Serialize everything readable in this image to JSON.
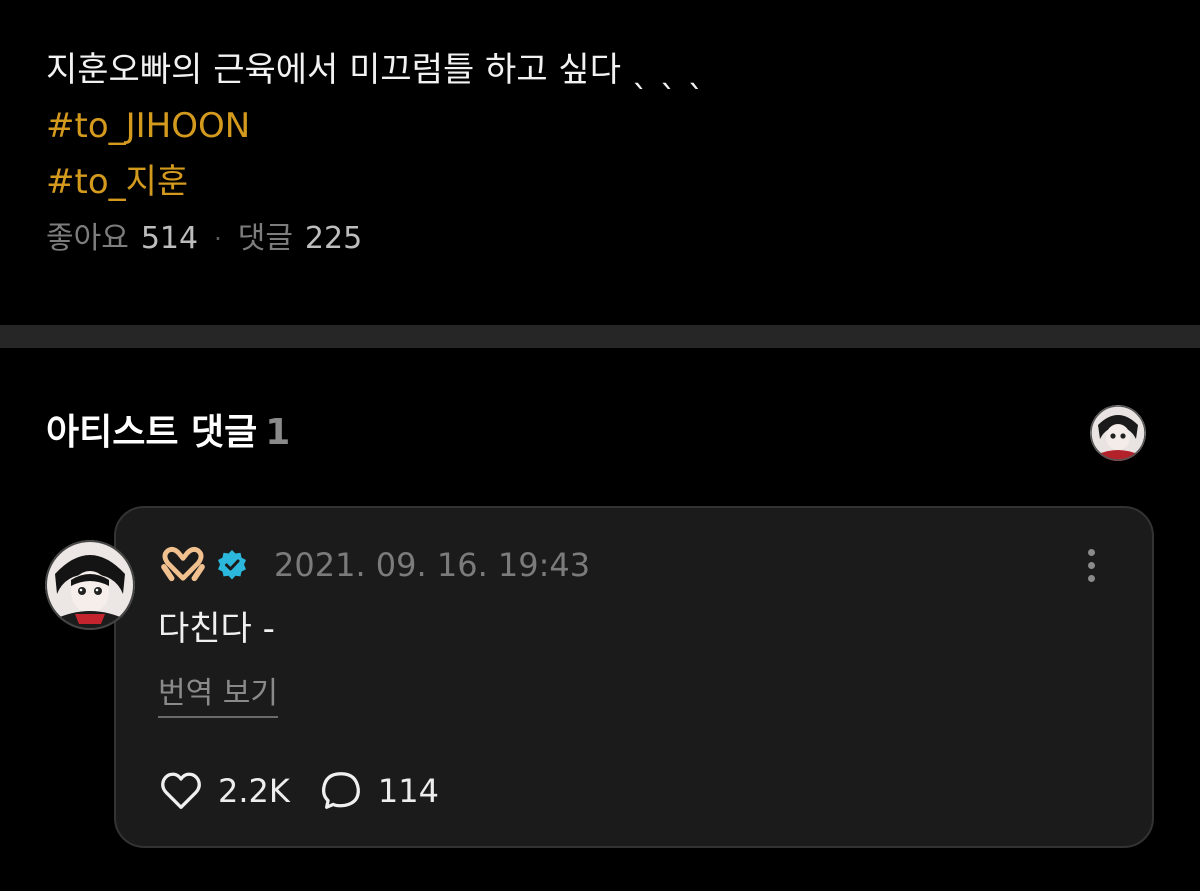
{
  "post": {
    "text": "지훈오빠의 근육에서 미끄럼틀 하고 싶다 ˎ ˎ ˎ",
    "hashtags": [
      "#to_JIHOON",
      "#to_지훈"
    ],
    "likes_label": "좋아요",
    "likes_count": "514",
    "separator": "·",
    "comments_label": "댓글",
    "comments_count": "225"
  },
  "artist_section": {
    "title": "아티스트 댓글",
    "count": "1"
  },
  "comment": {
    "author_icon": "heart-hands-emoji",
    "author_emoji": "🫶",
    "verified_icon": "verified-badge-icon",
    "timestamp": "2021. 09. 16. 19:43",
    "text": "다친다 -",
    "translate_label": "번역 보기",
    "like_count": "2.2K",
    "reply_count": "114"
  },
  "colors": {
    "background": "#000000",
    "hashtag": "#d49a1e",
    "card": "#1b1b1b",
    "verified": "#2bb8dc",
    "muted": "#7b7b7b"
  }
}
